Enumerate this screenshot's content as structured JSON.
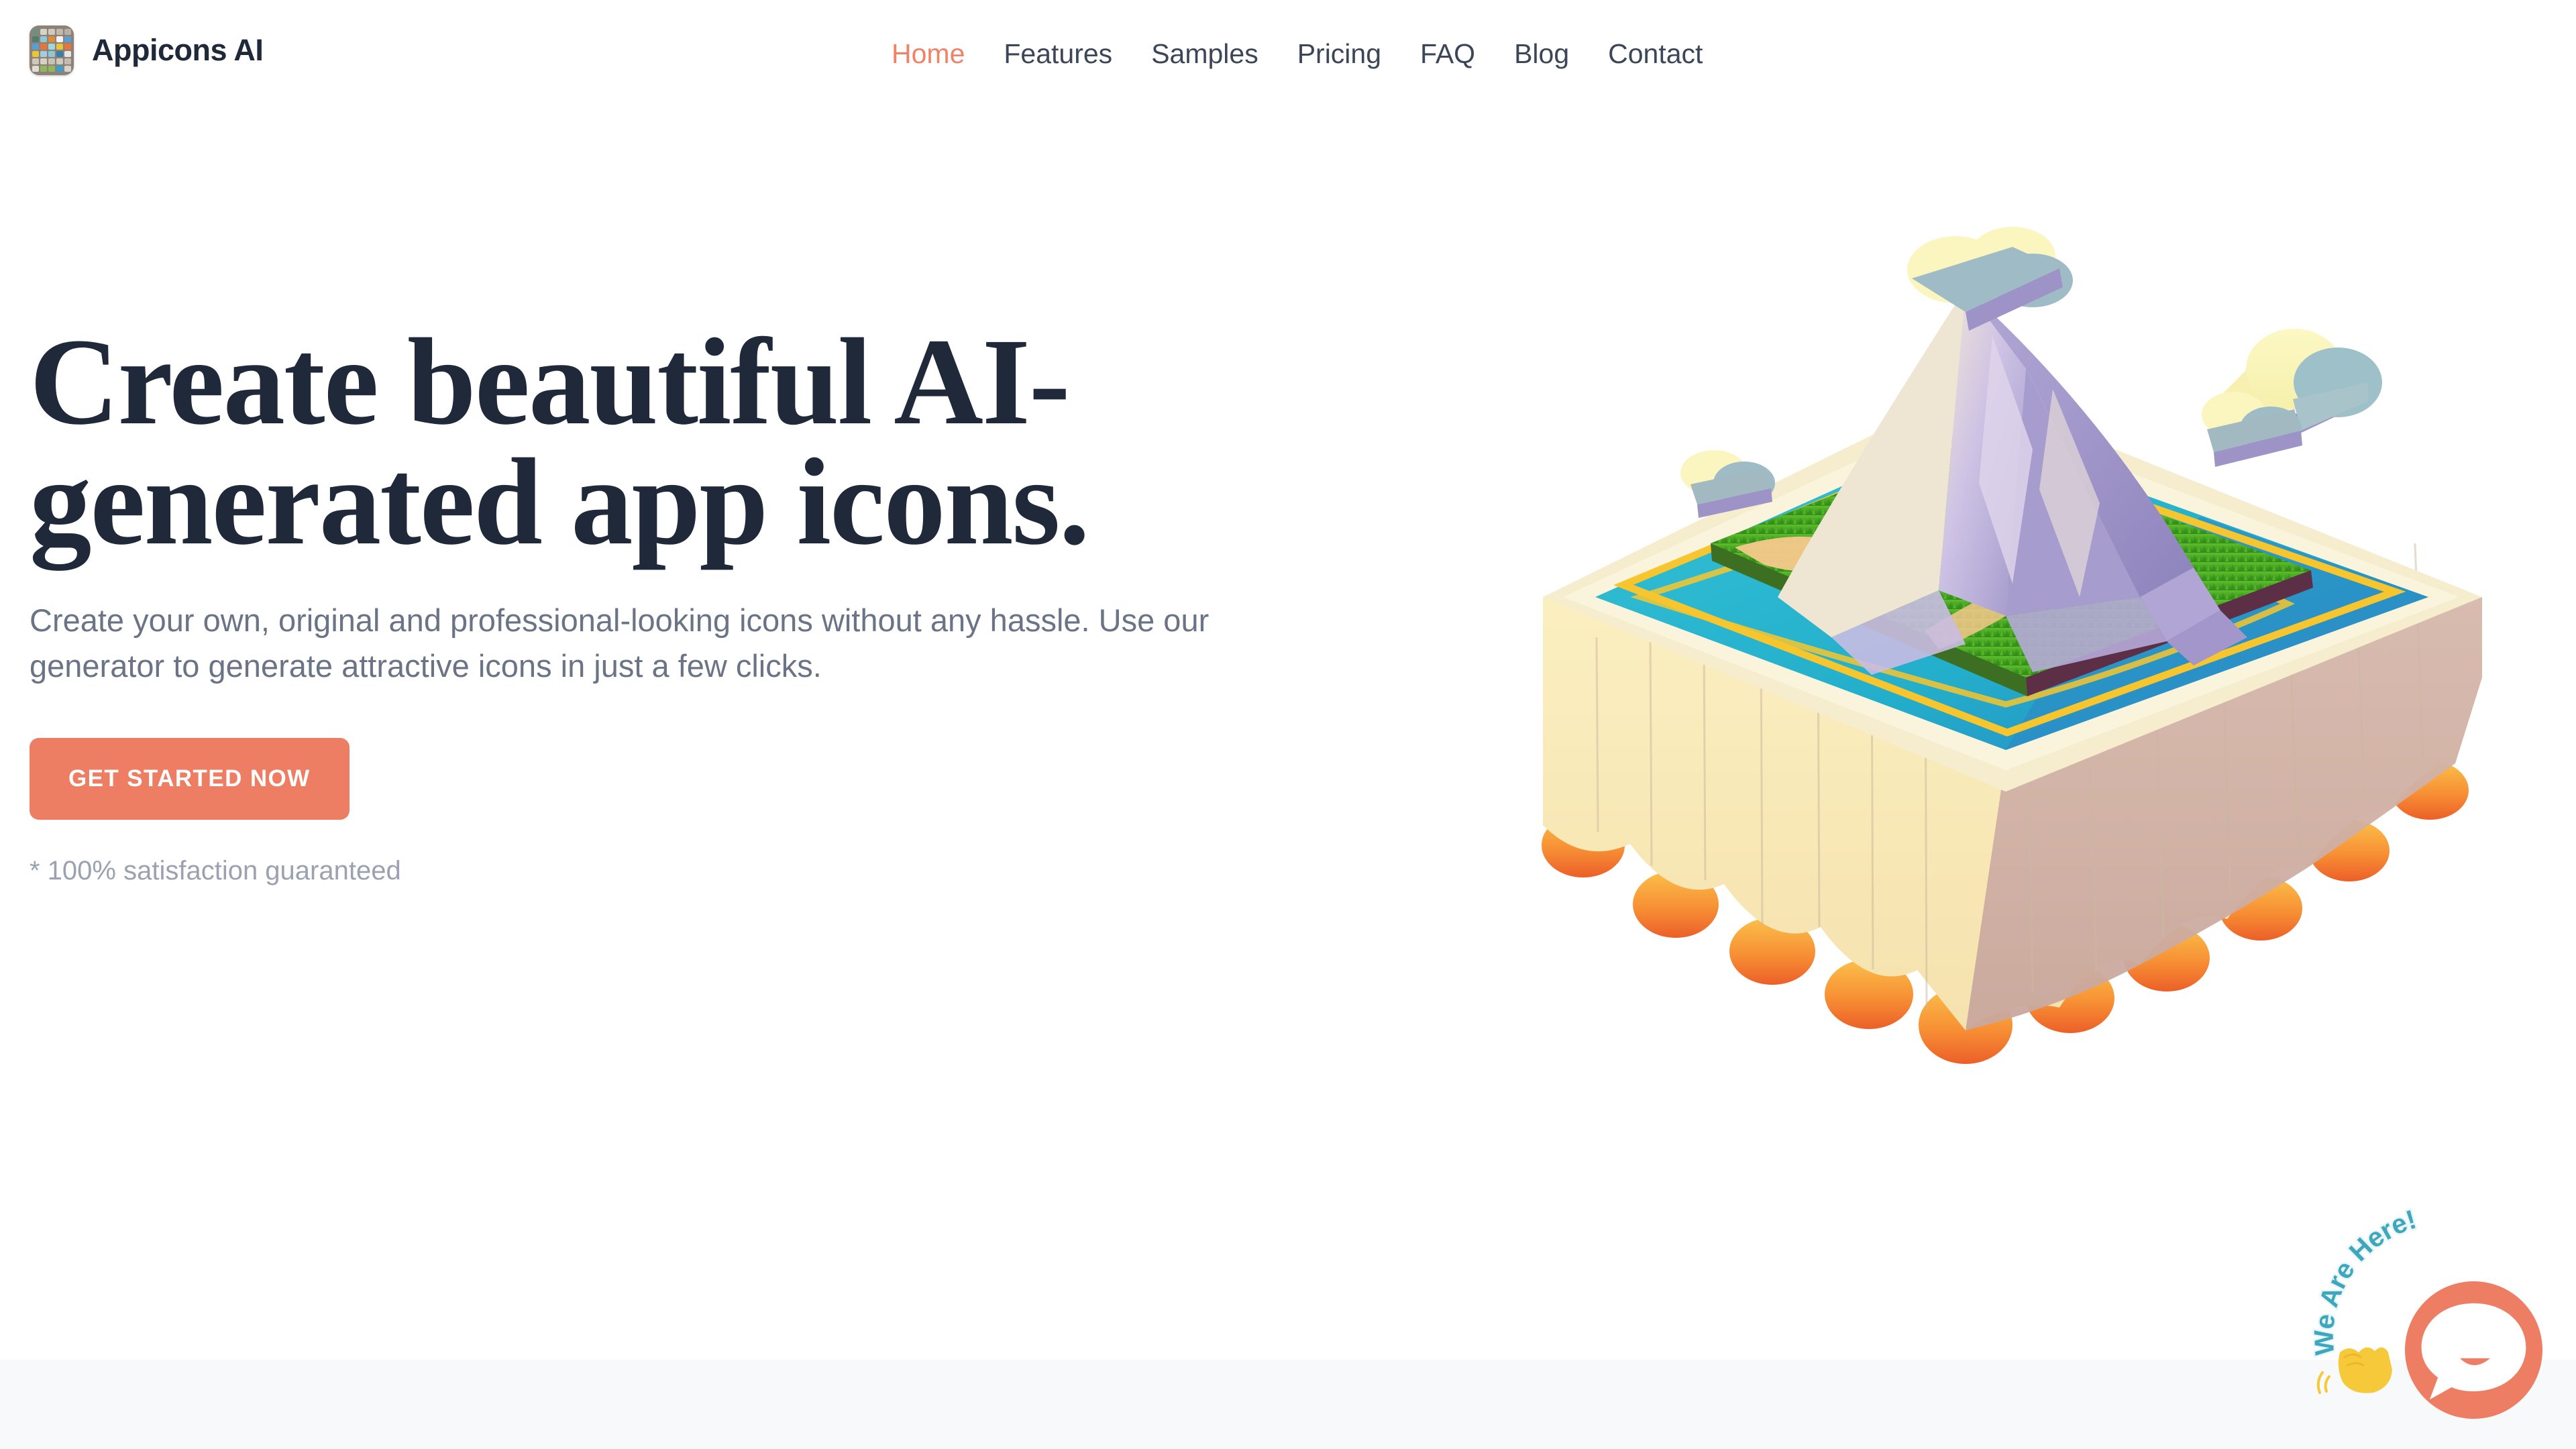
{
  "brand": {
    "name": "Appicons AI",
    "logo_icon": "app-grid-icon",
    "logo_tiles": [
      "#6f8f80",
      "#d4d3c8",
      "#cfcabf",
      "#c3b9a8",
      "#b9b0a2",
      "#4f7f6e",
      "#8fc8d4",
      "#e08a3c",
      "#f2f2f2",
      "#5a9fd4",
      "#5a9fd4",
      "#e8743a",
      "#9fd8d8",
      "#e8c63a",
      "#e8743a",
      "#e8c63a",
      "#9fcfe0",
      "#8fc8d4",
      "#3b7fa8",
      "#e6e6e6",
      "#cfc7ba",
      "#d8d2c6",
      "#c9c2b4",
      "#d2cabb",
      "#c4bcae",
      "#e0ddd4",
      "#8fb85a",
      "#8fb85a",
      "#3aa0c8",
      "#d9d4c8"
    ]
  },
  "nav": {
    "items": [
      {
        "label": "Home",
        "active": true
      },
      {
        "label": "Features",
        "active": false
      },
      {
        "label": "Samples",
        "active": false
      },
      {
        "label": "Pricing",
        "active": false
      },
      {
        "label": "FAQ",
        "active": false
      },
      {
        "label": "Blog",
        "active": false
      },
      {
        "label": "Contact",
        "active": false
      }
    ]
  },
  "hero": {
    "title": "Create beautiful AI-generated app icons.",
    "subtitle": "Create your own, original and professional-looking icons without any hassle. Use our generator to generate attractive icons in just a few clicks.",
    "cta_label": "GET STARTED NOW",
    "guarantee": "* 100% satisfaction guaranteed",
    "illustration_name": "isometric-island-volcano-3d-illustration"
  },
  "chat": {
    "label": "We Are Here!",
    "button_icon": "chat-bubble-icon",
    "hand_icon": "waving-hand-icon"
  },
  "colors": {
    "accent": "#ed7e63",
    "nav_active": "#f08267",
    "heading": "#20293a",
    "body_text": "#6b7486",
    "muted_text": "#9aa2b1",
    "nav_text": "#3c4659",
    "band": "#f8f9fb",
    "chat_label": "#3fa7bd",
    "hand": "#f5c93a"
  }
}
